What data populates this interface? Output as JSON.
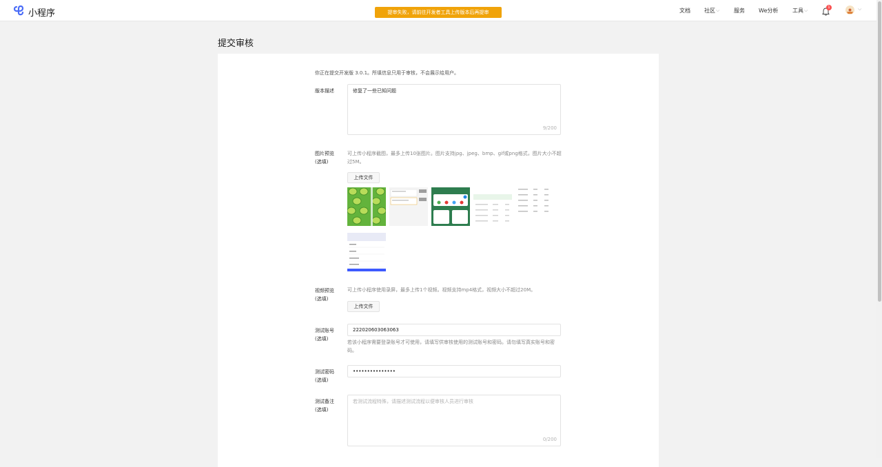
{
  "header": {
    "app_name": "小程序",
    "banner": "提审失败，请前往开发者工具上传版本后再提审",
    "nav": {
      "docs": "文档",
      "community": "社区",
      "service": "服务",
      "analytics": "We分析",
      "tools": "工具"
    },
    "notification_count": "1",
    "colors": {
      "banner": "#f0a30a",
      "badge": "#fa5151",
      "logo": "#4a6cf7"
    }
  },
  "page": {
    "title": "提交审核",
    "intro": "你正在提交开发版 3.0.1。所填信息只用于审核，不会展示给用户。"
  },
  "form": {
    "version_desc": {
      "label": "版本描述",
      "value": "修复了一些已知问题",
      "counter": "9/200"
    },
    "image_preview": {
      "label_line1": "图片预览",
      "label_line2": "(选填)",
      "hint": "可上传小程序截图，最多上传10张图片。图片支持jpg、jpeg、bmp、gif或png格式，图片大小不超过5M。",
      "upload_label": "上传文件"
    },
    "video_preview": {
      "label_line1": "视频预览",
      "label_line2": "(选填)",
      "hint": "可上传小程序使用录屏，最多上传1个视频。视频支持mp4格式，视频大小不超过20M。",
      "upload_label": "上传文件"
    },
    "test_account": {
      "label_line1": "测试账号",
      "label_line2": "(选填)",
      "value": "222020603063063",
      "hint": "若该小程序需要登录账号才可使用，请填写供审核使用的测试账号和密码。请勿填写真实账号和密码。"
    },
    "test_password": {
      "label_line1": "测试密码",
      "label_line2": "(选填)",
      "value": "•••••••••••••••"
    },
    "test_notes": {
      "label_line1": "测试备注",
      "label_line2": "(选填)",
      "placeholder": "若测试流程特殊，请描述测试流程以便审核人员进行审核",
      "counter": "0/200"
    }
  }
}
